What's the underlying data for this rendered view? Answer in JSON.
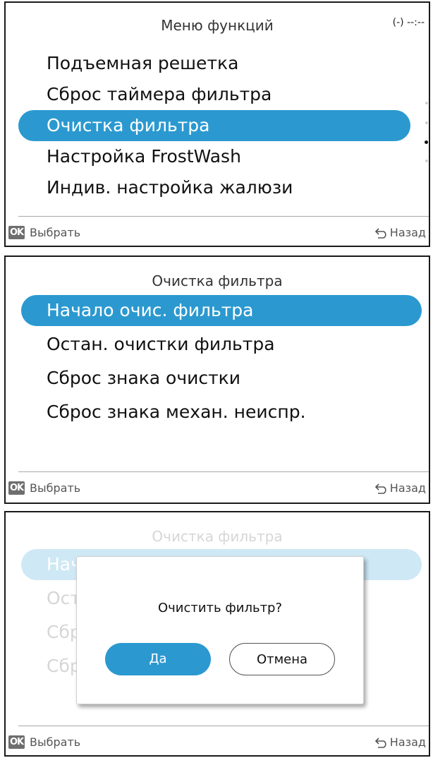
{
  "screen1": {
    "title": "Меню функций",
    "clock": "(-) --:--",
    "items": [
      "Подъемная решетка",
      "Сброс таймера фильтра",
      "Очистка фильтра",
      "Настройка FrostWash",
      "Индив. настройка жалюзи"
    ],
    "selected_index": 2,
    "scroll_position": "page 3 of 4",
    "footer": {
      "ok": "OK",
      "select": "Выбрать",
      "back": "Назад"
    }
  },
  "screen2": {
    "title": "Очистка фильтра",
    "items": [
      "Начало очис. фильтра",
      "Остан. очистки фильтра",
      "Сброс знака очистки",
      "Сброс знака механ. неиспр."
    ],
    "selected_index": 0,
    "footer": {
      "ok": "OK",
      "select": "Выбрать",
      "back": "Назад"
    }
  },
  "screen3": {
    "title": "Очистка фильтра",
    "items_visible_fragments": [
      "Нач",
      "Ост",
      "Сбр",
      "Сбр"
    ],
    "dialog": {
      "question": "Очистить фильтр?",
      "yes": "Да",
      "cancel": "Отмена"
    },
    "footer": {
      "ok": "OK",
      "select": "Выбрать",
      "back": "Назад"
    }
  },
  "colors": {
    "accent": "#2b99d0",
    "accent_dimmed": "#cfe8f5",
    "text": "#111111",
    "dimmed_text": "#d6d6d6"
  },
  "icons": [
    "back-arrow-icon",
    "ok-key-icon"
  ]
}
